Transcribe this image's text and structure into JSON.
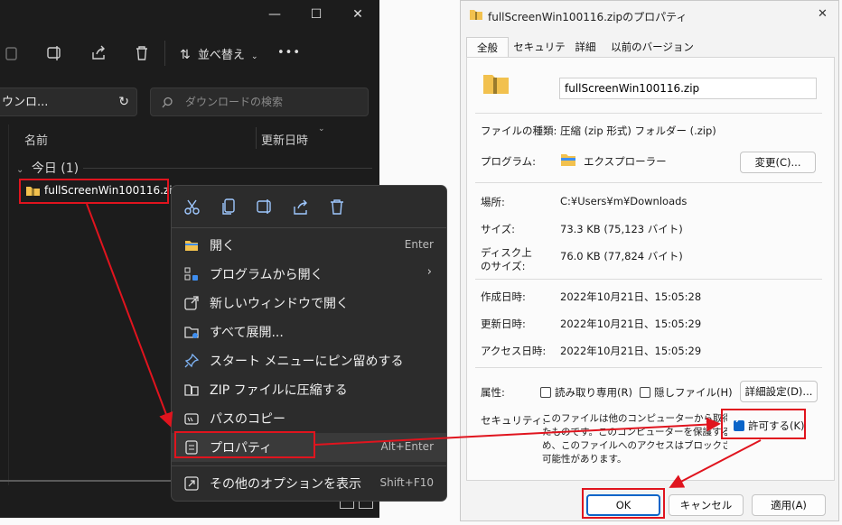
{
  "explorer": {
    "title_buttons": {
      "minimize": "—",
      "maximize": "☐",
      "close": "✕"
    },
    "toolbar": {
      "sort_label": "並べ替え",
      "more": "•••"
    },
    "address_text": "ウンロ...",
    "search_placeholder": "ダウンロードの検索",
    "col_name": "名前",
    "col_date": "更新日時",
    "group_label": "今日 (1)",
    "file_name": "fullScreenWin100116.zip"
  },
  "context_menu": {
    "items": [
      {
        "label": "開く",
        "shortcut": "Enter",
        "icon": "folder-icon"
      },
      {
        "label": "プログラムから開く",
        "shortcut": "",
        "icon": "open-with-icon"
      },
      {
        "label": "新しいウィンドウで開く",
        "shortcut": "",
        "icon": "new-window-icon"
      },
      {
        "label": "すべて展開...",
        "shortcut": "",
        "icon": "extract-icon"
      },
      {
        "label": "スタート メニューにピン留めする",
        "shortcut": "",
        "icon": "pin-icon"
      },
      {
        "label": "ZIP ファイルに圧縮する",
        "shortcut": "",
        "icon": "zip-icon"
      },
      {
        "label": "パスのコピー",
        "shortcut": "",
        "icon": "copy-path-icon"
      },
      {
        "label": "プロパティ",
        "shortcut": "Alt+Enter",
        "icon": "properties-icon"
      },
      {
        "label": "その他のオプションを表示",
        "shortcut": "Shift+F10",
        "icon": "more-options-icon"
      }
    ]
  },
  "properties": {
    "title": "fullScreenWin100116.zipのプロパティ",
    "close": "✕",
    "tabs": [
      "全般",
      "セキュリティ",
      "詳細",
      "以前のバージョン"
    ],
    "filename": "fullScreenWin100116.zip",
    "type_label": "ファイルの種類:",
    "type_value": "圧縮 (zip 形式) フォルダー (.zip)",
    "program_label": "プログラム:",
    "program_value": "エクスプローラー",
    "change_btn": "変更(C)...",
    "location_label": "場所:",
    "location_value": "C:¥Users¥m¥Downloads",
    "size_label": "サイズ:",
    "size_value": "73.3 KB (75,123 バイト)",
    "disk_label_1": "ディスク上",
    "disk_label_2": "のサイズ:",
    "disk_value": "76.0 KB (77,824 バイト)",
    "created_label": "作成日時:",
    "created_value": "2022年10月21日、15:05:28",
    "modified_label": "更新日時:",
    "modified_value": "2022年10月21日、15:05:29",
    "access_label": "アクセス日時:",
    "access_value": "2022年10月21日、15:05:29",
    "attr_label": "属性:",
    "readonly_label": "読み取り専用(R)",
    "hidden_label": "隠しファイル(H)",
    "advanced_btn": "詳細設定(D)...",
    "security_label": "セキュリティ:",
    "security_text_1": "このファイルは他のコンピューターから取得し",
    "security_text_2": "たものです。このコンピューターを保護するた",
    "security_text_3": "め、このファイルへのアクセスはブロックされる",
    "security_text_4": "可能性があります。",
    "unblock_label": "許可する(K)",
    "ok_btn": "OK",
    "cancel_btn": "キャンセル",
    "apply_btn": "適用(A)"
  },
  "colors": {
    "highlight_red": "#e0141e",
    "accent_blue": "#0a64c8",
    "folder_yellow": "#f2c14e"
  }
}
